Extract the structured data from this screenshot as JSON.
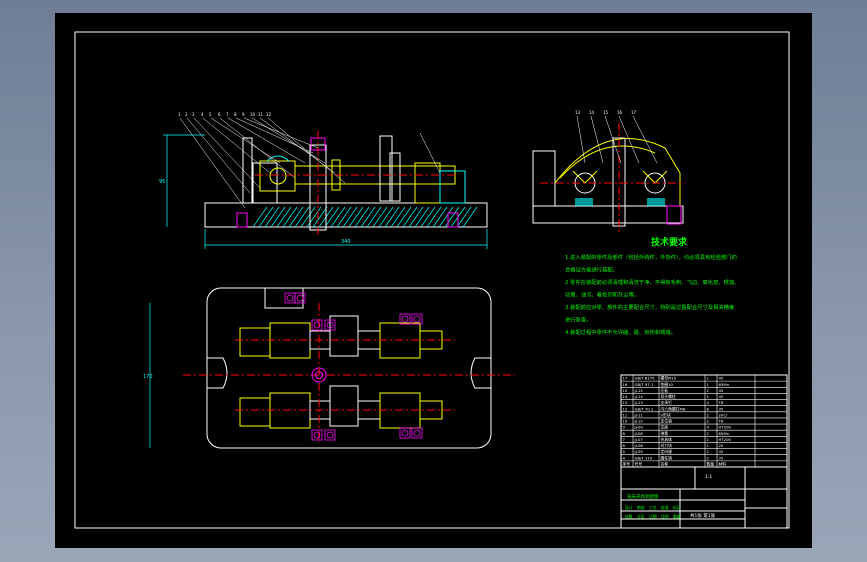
{
  "drawing": {
    "colors": {
      "frame": "#ffffff",
      "outline": "#ffffff",
      "part": "#ffff00",
      "hatch": "#00ffff",
      "centerline": "#ff0000",
      "note_text": "#00ff00",
      "fastener": "#ff00ff",
      "dimension": "#00ffff",
      "background": "#000000"
    },
    "dimensions": {
      "overall_length": "340",
      "front_height": "95",
      "plan_height": "170"
    },
    "callouts": [
      "1",
      "2",
      "3",
      "4",
      "5",
      "6",
      "7",
      "8",
      "9",
      "10",
      "11",
      "12"
    ],
    "side_callouts": [
      "13",
      "14",
      "15",
      "16",
      "17"
    ]
  },
  "notes": {
    "title": "技术要求",
    "lines": [
      "1.进入装配的零件及部件（包括外购件，外协件），均必须具有检验部门的",
      "  合格证方能进行装配。",
      "2.零件在装配前必须清理和清洗干净，不得有毛刺、飞边、氧化皮、锈蚀、",
      "  切屑、油污、着色剂和灰尘等。",
      "3.装配前应对零、部件的主要配合尺寸，特别是过盈配合尺寸及相关精度",
      "  进行复查。",
      "4.装配过程中零件不允许磕、碰、划伤和锈蚀。"
    ]
  },
  "bom": {
    "rows": [
      [
        "17",
        "GB/T 6170",
        "螺母M10",
        "1",
        "45"
      ],
      [
        "16",
        "GB/T 97.1",
        "垫圈10",
        "1",
        "65Mn"
      ],
      [
        "15",
        "JJ-15",
        "压板",
        "2",
        "45"
      ],
      [
        "14",
        "JJ-14",
        "双头螺柱",
        "1",
        "45"
      ],
      [
        "13",
        "JJ-13",
        "支承钉",
        "4",
        "T8"
      ],
      [
        "12",
        "GB/T 70.1",
        "内六角螺钉M8",
        "8",
        "35"
      ],
      [
        "11",
        "JJ-11",
        "V形块",
        "2",
        "20Cr"
      ],
      [
        "10",
        "JJ-10",
        "定位销",
        "2",
        "T8"
      ],
      [
        "9",
        "JJ-09",
        "支座",
        "4",
        "HT200"
      ],
      [
        "8",
        "JJ-08",
        "弹簧",
        "2",
        "65Mn"
      ],
      [
        "7",
        "JJ-07",
        "夹具体",
        "1",
        "HT200"
      ],
      [
        "6",
        "JJ-06",
        "对刀块",
        "1",
        "20"
      ],
      [
        "5",
        "JJ-05",
        "定向键",
        "2",
        "45"
      ],
      [
        "4",
        "GB/T 119",
        "圆柱销",
        "2",
        "35"
      ]
    ],
    "header": [
      "序号",
      "代号",
      "名称",
      "数量",
      "材料"
    ]
  },
  "title_block": {
    "drawing_name": "铣床夹具装配图",
    "scale": "1:1",
    "sheet": "共1张 第1张",
    "labels": [
      "设计",
      "审核",
      "工艺",
      "批准",
      "标记",
      "处数",
      "分区",
      "日期",
      "比例",
      "重量"
    ]
  }
}
